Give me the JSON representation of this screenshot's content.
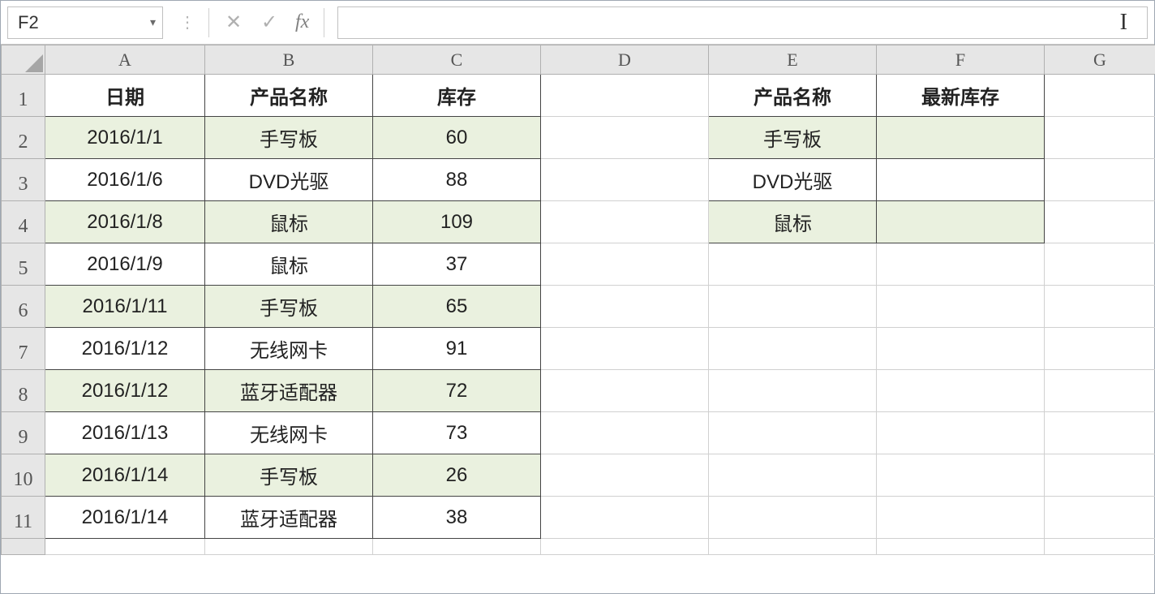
{
  "nameBox": "F2",
  "formula": "",
  "fxLabel": "fx",
  "columns": [
    "A",
    "B",
    "C",
    "D",
    "E",
    "F",
    "G"
  ],
  "rowHeaders": [
    "1",
    "2",
    "3",
    "4",
    "5",
    "6",
    "7",
    "8",
    "9",
    "10",
    "11"
  ],
  "headerRow": {
    "A": "日期",
    "B": "产品名称",
    "C": "库存",
    "E": "产品名称",
    "F": "最新库存"
  },
  "data": [
    {
      "A": "2016/1/1",
      "B": "手写板",
      "C": "60",
      "E": "手写板",
      "F": ""
    },
    {
      "A": "2016/1/6",
      "B": "DVD光驱",
      "C": "88",
      "E": "DVD光驱",
      "F": ""
    },
    {
      "A": "2016/1/8",
      "B": "鼠标",
      "C": "109",
      "E": "鼠标",
      "F": ""
    },
    {
      "A": "2016/1/9",
      "B": "鼠标",
      "C": "37"
    },
    {
      "A": "2016/1/11",
      "B": "手写板",
      "C": "65"
    },
    {
      "A": "2016/1/12",
      "B": "无线网卡",
      "C": "91"
    },
    {
      "A": "2016/1/12",
      "B": "蓝牙适配器",
      "C": "72"
    },
    {
      "A": "2016/1/13",
      "B": "无线网卡",
      "C": "73"
    },
    {
      "A": "2016/1/14",
      "B": "手写板",
      "C": "26"
    },
    {
      "A": "2016/1/14",
      "B": "蓝牙适配器",
      "C": "38"
    }
  ]
}
